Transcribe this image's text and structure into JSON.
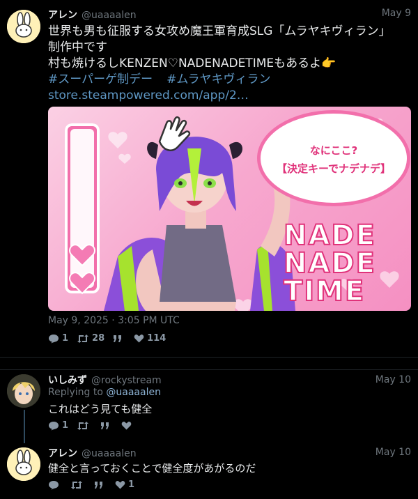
{
  "tweet1": {
    "name": "アレン",
    "handle": "@uaaaalen",
    "date": "May 9",
    "line1": "世界も男も征服する女攻め魔王軍育成SLG「ムラヤキヴィラン」",
    "line2": "制作中です",
    "line3": "村も焼けるしKENZEN♡NADENADETIMEもあるよ👉",
    "hashtag1": "#スーパーゲ制デー",
    "hashtag2": "#ムラヤキヴィラン",
    "url": "store.steampowered.com/app/2…",
    "card": {
      "bubble_line1": "なにここ?",
      "bubble_line2": "【決定キーでナデナデ】",
      "logo": [
        "NADE",
        "NADE",
        "TIME"
      ]
    },
    "timestamp": "May 9, 2025 · 3:05 PM UTC",
    "replies": "1",
    "retweets": "28",
    "likes": "114"
  },
  "tweet2": {
    "name": "いしみず",
    "handle": "@rockystream",
    "date": "May 10",
    "replying_prefix": "Replying to ",
    "replying_handle": "@uaaaalen",
    "text": "これはどう見ても健全",
    "replies": "1"
  },
  "tweet3": {
    "name": "アレン",
    "handle": "@uaaaalen",
    "date": "May 10",
    "text": "健全と言っておくことで健全度があがるのだ",
    "likes": "1"
  },
  "colors": {
    "background": "#000000",
    "link": "#5f98c5",
    "muted": "#6e767d",
    "card_pink": "#f590c2",
    "accent_pink": "#e0327a"
  }
}
